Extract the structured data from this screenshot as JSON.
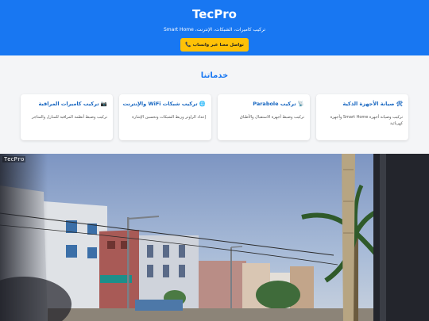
{
  "hero": {
    "title": "TecPro",
    "subtitle": "تركيب كاميرات، الشبكات، الإنترنت، Smart Home",
    "cta_label": "تواصل معنا عبر واتساب",
    "cta_icon": "phone-icon"
  },
  "services": {
    "title": "خدماتنا",
    "cards": [
      {
        "title": "صيانة الأجهزة الذكية",
        "icon": "tools-icon",
        "desc": "تركيب وصيانة أجهزة Smart Home وأجهزة كهربائية"
      },
      {
        "title": "تركيب Parabole",
        "icon": "satellite-dish-icon",
        "desc": "تركيب وضبط أجهزة الاستقبال والأطباق"
      },
      {
        "title": "تركيب شبكات WiFi والإنترنت",
        "icon": "globe-icon",
        "desc": "إعداد الراوتر وربط الشبكات وتحسين الإشارة"
      },
      {
        "title": "تركيب كاميرات المراقبة",
        "icon": "camera-icon",
        "desc": "تركيب وضبط أنظمة المراقبة للمنازل والمتاجر"
      }
    ]
  },
  "photo": {
    "watermark": "TecPro"
  },
  "colors": {
    "brand_blue": "#1877f2",
    "cta_yellow": "#ffc107",
    "card_title_blue": "#1565c0"
  }
}
